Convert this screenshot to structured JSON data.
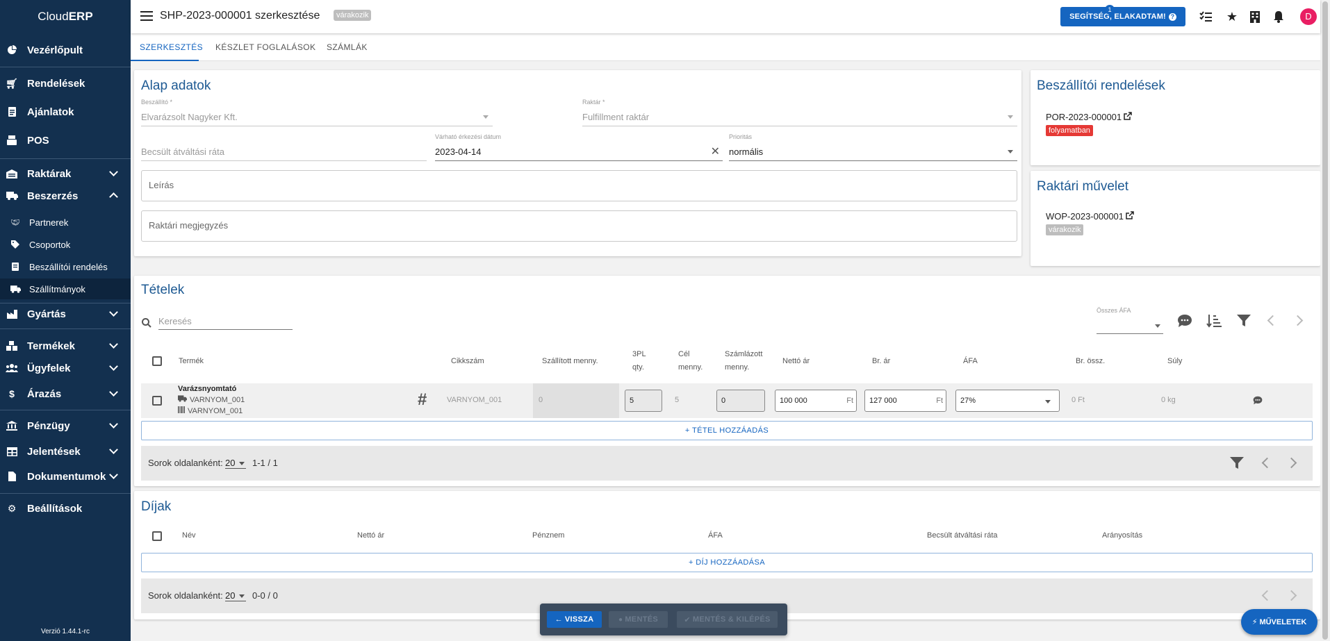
{
  "app": {
    "brand_prefix": "Cloud",
    "brand_suffix": "ERP",
    "version": "Verzió 1.44.1-rc"
  },
  "sidebar": {
    "items": [
      {
        "label": "Vezérlőpult",
        "icon": "dashboard-icon"
      },
      {
        "label": "Rendelések",
        "icon": "cart-icon"
      },
      {
        "label": "Ajánlatok",
        "icon": "document-icon"
      },
      {
        "label": "POS",
        "icon": "pos-icon"
      },
      {
        "label": "Raktárak",
        "icon": "warehouse-icon"
      },
      {
        "label": "Beszerzés",
        "icon": "truck-icon"
      },
      {
        "label": "Gyártás",
        "icon": "factory-icon"
      },
      {
        "label": "Termékek",
        "icon": "products-icon"
      },
      {
        "label": "Ügyfelek",
        "icon": "users-icon"
      },
      {
        "label": "Árazás",
        "icon": "dollar-icon"
      },
      {
        "label": "Pénzügy",
        "icon": "bank-icon"
      },
      {
        "label": "Jelentések",
        "icon": "table-icon"
      },
      {
        "label": "Dokumentumok",
        "icon": "file-icon"
      },
      {
        "label": "Beállítások",
        "icon": "gear-icon"
      }
    ],
    "sub_items": [
      {
        "label": "Partnerek",
        "icon": "handshake-icon"
      },
      {
        "label": "Csoportok",
        "icon": "tags-icon"
      },
      {
        "label": "Beszállítói rendelés",
        "icon": "receipt-icon"
      },
      {
        "label": "Szállítmányok",
        "icon": "truck-icon"
      }
    ]
  },
  "header": {
    "title": "SHP-2023-000001 szerkesztése",
    "status": "várakozik",
    "help_label": "SEGÍTSÉG, ELAKADTAM!",
    "notifications_count": "1",
    "avatar": "D"
  },
  "tabs": [
    "SZERKESZTÉS",
    "KÉSZLET FOGLALÁSOK",
    "SZÁMLÁK"
  ],
  "basic": {
    "title": "Alap adatok",
    "supplier_label": "Beszállító *",
    "supplier_value": "Elvarázsolt Nagyker Kft.",
    "warehouse_label": "Raktár *",
    "warehouse_value": "Fulfillment raktár",
    "rate_placeholder": "Becsült átváltási ráta",
    "date_label": "Várható érkezési dátum",
    "date_value": "2023-04-14",
    "priority_label": "Prioritás",
    "priority_value": "normális",
    "description_placeholder": "Leírás",
    "note_placeholder": "Raktári megjegyzés"
  },
  "supplier_orders": {
    "title": "Beszállítói rendelések",
    "link": "POR-2023-000001",
    "status": "folyamatban",
    "status_color": "#e53935"
  },
  "warehouse_ops": {
    "title": "Raktári művelet",
    "link": "WOP-2023-000001",
    "status": "várakozik",
    "status_color": "#bdbdbd"
  },
  "items": {
    "title": "Tételek",
    "search_placeholder": "Keresés",
    "vat_filter_label": "Összes ÁFA",
    "columns": {
      "product": "Termék",
      "sku": "Cikkszám",
      "shipped": "Szállított menny.",
      "tpl_a": "3PL",
      "tpl_b": "qty.",
      "target_a": "Cél",
      "target_b": "menny.",
      "invoiced_a": "Számlázott",
      "invoiced_b": "menny.",
      "net": "Nettó ár",
      "gross": "Br. ár",
      "vat": "ÁFA",
      "gross_total": "Br. össz.",
      "weight": "Súly"
    },
    "rows": [
      {
        "name": "Varázsnyomtató",
        "code1": "VARNYOM_001",
        "code2": "VARNYOM_001",
        "sku": "VARNYOM_001",
        "shipped": "0",
        "tpl_qty": "5",
        "target": "5",
        "invoiced": "0",
        "net": "100 000",
        "net_unit": "Ft",
        "gross": "127 000",
        "gross_unit": "Ft",
        "vat": "27%",
        "gross_total": "0 Ft",
        "weight": "0 kg"
      }
    ],
    "add_label": "TÉTEL HOZZÁADÁS",
    "rows_per_page_label": "Sorok oldalanként:",
    "rows_per_page": "20",
    "count": "1-1 / 1"
  },
  "fees": {
    "title": "Díjak",
    "columns": {
      "name": "Név",
      "net": "Nettó ár",
      "currency": "Pénznem",
      "vat": "ÁFA",
      "rate": "Becsült átváltási ráta",
      "proportion": "Arányosítás"
    },
    "add_label": "DÍJ HOZZÁADÁSA",
    "rows_per_page_label": "Sorok oldalanként:",
    "rows_per_page": "20",
    "count": "0-0 / 0"
  },
  "actions": {
    "back": "VISSZA",
    "save": "MENTÉS",
    "save_exit": "MENTÉS & KILÉPÉS",
    "operations": "MŰVELETEK"
  },
  "colors": {
    "sidebar": "#13304f",
    "accent": "#1565c0",
    "title": "#1e5a93",
    "avatar": "#e91e63"
  }
}
